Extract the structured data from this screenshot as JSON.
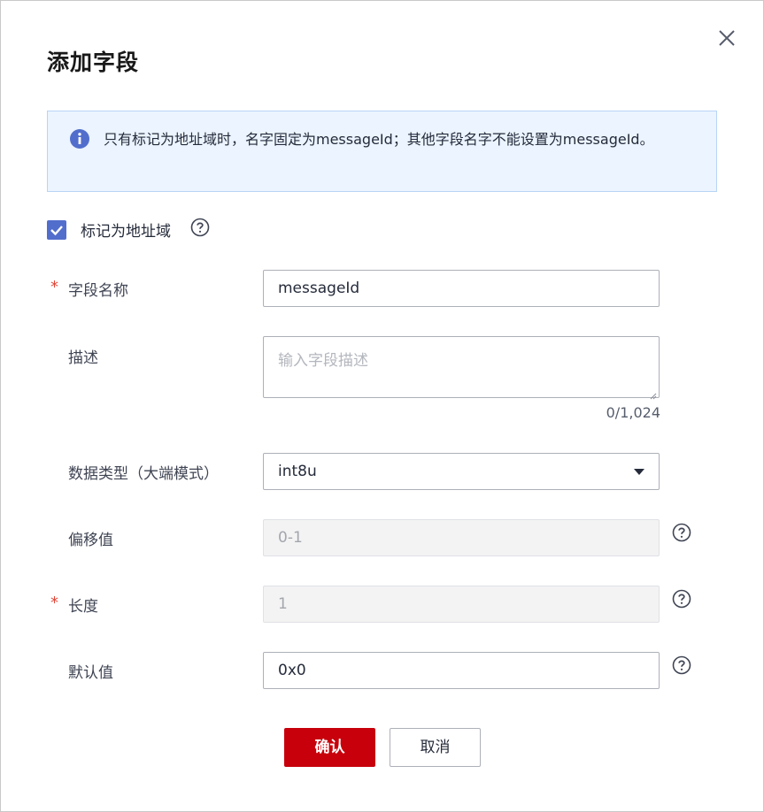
{
  "dialog": {
    "title": "添加字段",
    "notice": "只有标记为地址域时，名字固定为messageId；其他字段名字不能设置为messageId。",
    "mark_address": {
      "label": "标记为地址域",
      "checked": true
    },
    "fields": {
      "name": {
        "required": "*",
        "label": "字段名称",
        "value": "messageId"
      },
      "description": {
        "label": "描述",
        "placeholder": "输入字段描述",
        "counter": "0/1,024"
      },
      "data_type": {
        "label": "数据类型（大端模式）",
        "value": "int8u"
      },
      "offset": {
        "label": "偏移值",
        "value": "0-1"
      },
      "length": {
        "required": "*",
        "label": "长度",
        "value": "1"
      },
      "default": {
        "label": "默认值",
        "value": "0x0"
      }
    },
    "buttons": {
      "confirm": "确认",
      "cancel": "取消"
    }
  },
  "colors": {
    "primary": "#c7000b",
    "checkbox": "#526ecc",
    "info": "#526ecc",
    "notice_bg": "#ebf4ff",
    "required": "#e0473a"
  },
  "icons": [
    "close-icon",
    "info-icon",
    "check-icon",
    "help-icon",
    "chevron-down-icon",
    "resize-handle-icon"
  ]
}
